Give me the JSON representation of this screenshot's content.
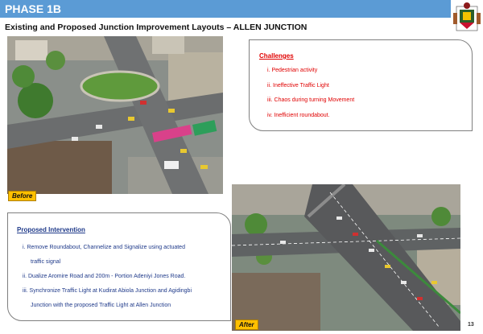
{
  "header": {
    "title": "PHASE 1B"
  },
  "subtitle": "Existing and Proposed Junction Improvement Layouts – ALLEN JUNCTION",
  "before_label": "Before",
  "after_label": "After",
  "challenges": {
    "heading": "Challenges",
    "items": [
      "i.  Pedestrian activity",
      "ii. Ineffective Traffic Light",
      "iii. Chaos during turning Movement",
      "iv. Inefficient roundabout."
    ]
  },
  "proposed": {
    "heading": "Proposed Intervention",
    "item1_a": "i.  Remove Roundabout, Channelize and Signalize using actuated",
    "item1_b": "traffic signal",
    "item2": "ii. Dualize Aromire Road and  200m - Portion Adeniyi Jones Road.",
    "item3_a": "iii. Synchronize Traffic Light at Kudirat Abiola Junction and Agidingbi",
    "item3_b": "Junction with the proposed Traffic Light at Allen Junction"
  },
  "page_number": "13",
  "colors": {
    "header": "#5b9bd5",
    "challenges_text": "#e00000",
    "proposed_text": "#1f3a8a",
    "tag": "#ffc000"
  }
}
